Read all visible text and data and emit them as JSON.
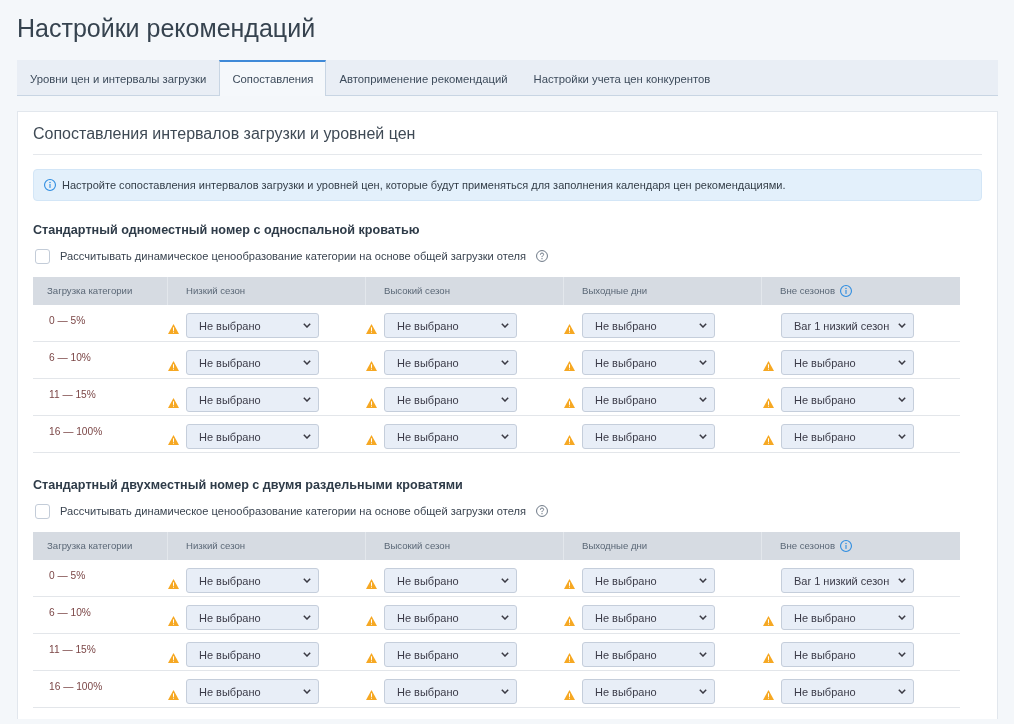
{
  "page": {
    "title": "Настройки рекомендаций"
  },
  "tabs": [
    {
      "label": "Уровни цен и интервалы загрузки",
      "selected": false
    },
    {
      "label": "Сопоставления",
      "selected": true
    },
    {
      "label": "Автоприменение рекомендаций",
      "selected": false
    },
    {
      "label": "Настройки учета цен конкурентов",
      "selected": false
    }
  ],
  "card": {
    "title": "Сопоставления интервалов загрузки и уровней цен",
    "info": "Настройте сопоставления интервалов загрузки и уровней цен, которые будут применяться для заполнения календаря цен рекомендациями.",
    "categories": [
      {
        "name": "Стандартный одноместный номер с односпальной кроватью",
        "dynamic_pricing": {
          "label": "Рассчитывать динамическое ценообразование категории на основе общей загрузки отеля",
          "checked": false
        },
        "table": {
          "columns": [
            {
              "label": "Загрузка категории",
              "info": false
            },
            {
              "label": "Низкий сезон",
              "info": false
            },
            {
              "label": "Высокий сезон",
              "info": false
            },
            {
              "label": "Выходные дни",
              "info": false
            },
            {
              "label": "Вне сезонов",
              "info": true
            }
          ],
          "rows": [
            {
              "cells": [
                {
                  "kind": "text",
                  "value": "0 — 5%"
                },
                {
                  "kind": "select",
                  "value": "Не выбрано",
                  "warning": true
                },
                {
                  "kind": "select",
                  "value": "Не выбрано",
                  "warning": true
                },
                {
                  "kind": "select",
                  "value": "Не выбрано",
                  "warning": true
                },
                {
                  "kind": "select",
                  "value": "Bar 1 низкий сезон",
                  "warning": false
                }
              ]
            },
            {
              "cells": [
                {
                  "kind": "text",
                  "value": "6 — 10%"
                },
                {
                  "kind": "select",
                  "value": "Не выбрано",
                  "warning": true
                },
                {
                  "kind": "select",
                  "value": "Не выбрано",
                  "warning": true
                },
                {
                  "kind": "select",
                  "value": "Не выбрано",
                  "warning": true
                },
                {
                  "kind": "select",
                  "value": "Не выбрано",
                  "warning": true
                }
              ]
            },
            {
              "cells": [
                {
                  "kind": "text",
                  "value": "11 — 15%"
                },
                {
                  "kind": "select",
                  "value": "Не выбрано",
                  "warning": true
                },
                {
                  "kind": "select",
                  "value": "Не выбрано",
                  "warning": true
                },
                {
                  "kind": "select",
                  "value": "Не выбрано",
                  "warning": true
                },
                {
                  "kind": "select",
                  "value": "Не выбрано",
                  "warning": true
                }
              ]
            },
            {
              "cells": [
                {
                  "kind": "text",
                  "value": "16 — 100%"
                },
                {
                  "kind": "select",
                  "value": "Не выбрано",
                  "warning": true
                },
                {
                  "kind": "select",
                  "value": "Не выбрано",
                  "warning": true
                },
                {
                  "kind": "select",
                  "value": "Не выбрано",
                  "warning": true
                },
                {
                  "kind": "select",
                  "value": "Не выбрано",
                  "warning": true
                }
              ]
            }
          ]
        }
      },
      {
        "name": "Стандартный двухместный номер с двумя раздельными кроватями",
        "dynamic_pricing": {
          "label": "Рассчитывать динамическое ценообразование категории на основе общей загрузки отеля",
          "checked": false
        },
        "table": {
          "columns": [
            {
              "label": "Загрузка категории",
              "info": false
            },
            {
              "label": "Низкий сезон",
              "info": false
            },
            {
              "label": "Высокий сезон",
              "info": false
            },
            {
              "label": "Выходные дни",
              "info": false
            },
            {
              "label": "Вне сезонов",
              "info": true
            }
          ],
          "rows": [
            {
              "cells": [
                {
                  "kind": "text",
                  "value": "0 — 5%"
                },
                {
                  "kind": "select",
                  "value": "Не выбрано",
                  "warning": true
                },
                {
                  "kind": "select",
                  "value": "Не выбрано",
                  "warning": true
                },
                {
                  "kind": "select",
                  "value": "Не выбрано",
                  "warning": true
                },
                {
                  "kind": "select",
                  "value": "Bar 1 низкий сезон",
                  "warning": false
                }
              ]
            },
            {
              "cells": [
                {
                  "kind": "text",
                  "value": "6 — 10%"
                },
                {
                  "kind": "select",
                  "value": "Не выбрано",
                  "warning": true
                },
                {
                  "kind": "select",
                  "value": "Не выбрано",
                  "warning": true
                },
                {
                  "kind": "select",
                  "value": "Не выбрано",
                  "warning": true
                },
                {
                  "kind": "select",
                  "value": "Не выбрано",
                  "warning": true
                }
              ]
            },
            {
              "cells": [
                {
                  "kind": "text",
                  "value": "11 — 15%"
                },
                {
                  "kind": "select",
                  "value": "Не выбрано",
                  "warning": true
                },
                {
                  "kind": "select",
                  "value": "Не выбрано",
                  "warning": true
                },
                {
                  "kind": "select",
                  "value": "Не выбрано",
                  "warning": true
                },
                {
                  "kind": "select",
                  "value": "Не выбрано",
                  "warning": true
                }
              ]
            },
            {
              "cells": [
                {
                  "kind": "text",
                  "value": "16 — 100%"
                },
                {
                  "kind": "select",
                  "value": "Не выбрано",
                  "warning": true
                },
                {
                  "kind": "select",
                  "value": "Не выбрано",
                  "warning": true
                },
                {
                  "kind": "select",
                  "value": "Не выбрано",
                  "warning": true
                },
                {
                  "kind": "select",
                  "value": "Не выбрано",
                  "warning": true
                }
              ]
            }
          ]
        }
      }
    ]
  }
}
